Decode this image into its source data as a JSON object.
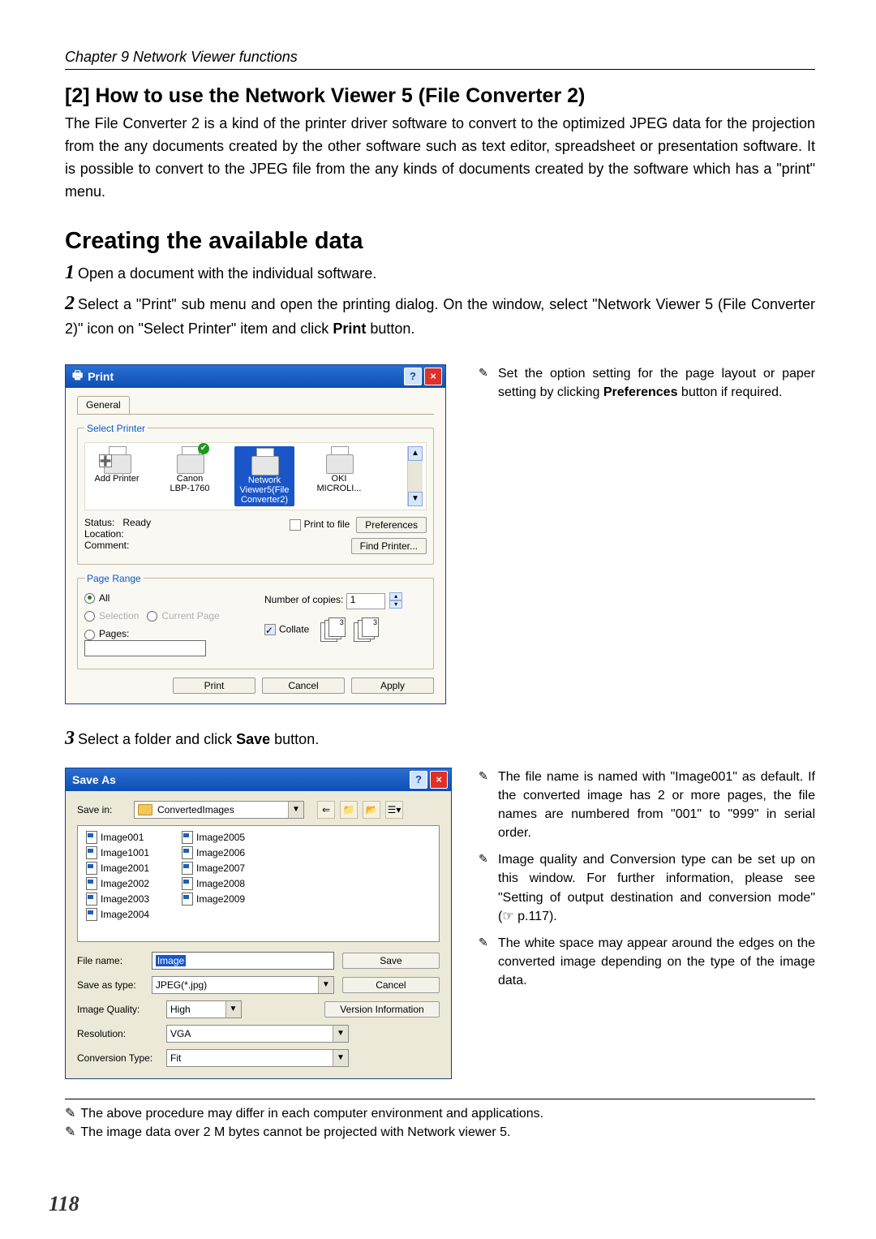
{
  "header": {
    "chapter": "Chapter 9 Network Viewer functions",
    "title": "[2] How to use the Network Viewer 5 (File Converter 2)"
  },
  "intro": "The File Converter 2 is a kind of the printer driver software to convert to the optimized JPEG data for the projection from the any documents created by the other software such as text editor, spreadsheet or presentation software. It is possible to convert to the JPEG file from the any kinds of documents created by the software which has a \"print\" menu.",
  "section_h2": "Creating the available data",
  "steps": {
    "s1": "Open a document with the individual software.",
    "s2a": "Select a \"Print\" sub menu and open the printing dialog. On the window, select \"Network Viewer 5 (File Converter 2)\" icon on \"Select Printer\" item and click ",
    "s2b": "Print",
    "s2c": " button.",
    "s3a": "Select a folder and click ",
    "s3b": "Save",
    "s3c": " button."
  },
  "note_top_a": "Set the option setting for the page layout or paper setting by clicking ",
  "note_top_b": "Preferences",
  "note_top_c": " button if required.",
  "notes2": {
    "n1": "The file name is named with \"Image001\" as  default. If the converted image has 2 or more pages, the file names are numbered from \"001\" to \"999\" in serial order.",
    "n2": "Image quality and Conversion type can be set up on this window. For further information, please see \"Setting of output destination and conversion mode\" (☞ p.117).",
    "n3": "The white space may appear around the edges on the converted image depending on the type of the image data."
  },
  "footnotes": {
    "f1": "The above procedure may differ in each computer environment and applications.",
    "f2": "The image data over 2 M bytes cannot be projected with Network viewer 5."
  },
  "page_number": "118",
  "print_dialog": {
    "title": "Print",
    "tab": "General",
    "legend_printer": "Select Printer",
    "printers": {
      "p1": "Add Printer",
      "p2a": "Canon",
      "p2b": "LBP-1760",
      "p3a": "Network",
      "p3b": "Viewer5(File",
      "p3c": "Converter2)",
      "p4a": "OKI",
      "p4b": "MICROLI..."
    },
    "status_lbl": "Status:",
    "status_val": "Ready",
    "location_lbl": "Location:",
    "comment_lbl": "Comment:",
    "print_to_file": "Print to file",
    "preferences": "Preferences",
    "find_printer": "Find Printer...",
    "legend_range": "Page Range",
    "all": "All",
    "selection": "Selection",
    "current": "Current Page",
    "pages": "Pages:",
    "copies_lbl": "Number of copies:",
    "copies_val": "1",
    "collate": "Collate",
    "btn_print": "Print",
    "btn_cancel": "Cancel",
    "btn_apply": "Apply"
  },
  "save_dialog": {
    "title": "Save As",
    "save_in_lbl": "Save in:",
    "save_in_val": "ConvertedImages",
    "files_col1": [
      "Image001",
      "Image1001",
      "Image2001",
      "Image2002",
      "Image2003",
      "Image2004"
    ],
    "files_col2": [
      "Image2005",
      "Image2006",
      "Image2007",
      "Image2008",
      "Image2009"
    ],
    "file_name_lbl": "File name:",
    "file_name_val": "Image",
    "save_as_type_lbl": "Save as type:",
    "save_as_type_val": "JPEG(*.jpg)",
    "quality_lbl": "Image Quality:",
    "quality_val": "High",
    "res_lbl": "Resolution:",
    "res_val": "VGA",
    "conv_lbl": "Conversion Type:",
    "conv_val": "Fit",
    "btn_save": "Save",
    "btn_cancel": "Cancel",
    "btn_version": "Version Information"
  }
}
